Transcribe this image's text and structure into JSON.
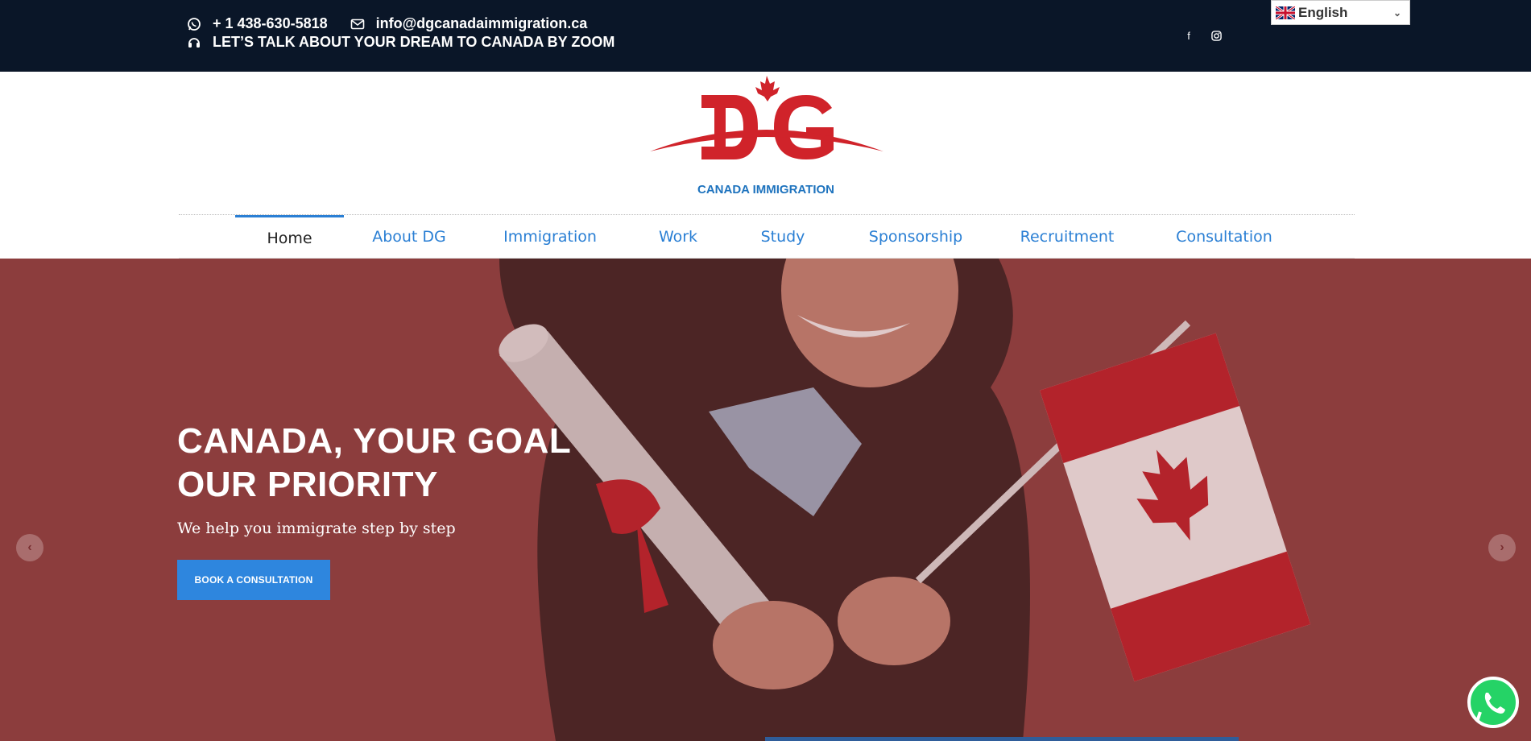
{
  "topbar": {
    "phone": "+ 1 438-630-5818",
    "email": "info@dgcanadaimmigration.ca",
    "zoom": "LET’S TALK ABOUT YOUR DREAM TO CANADA BY ZOOM",
    "language": "English"
  },
  "logo": {
    "letters": "DG",
    "tagline": "CANADA IMMIGRATION"
  },
  "nav": {
    "items": [
      {
        "label": "Home"
      },
      {
        "label": "About DG"
      },
      {
        "label": "Immigration"
      },
      {
        "label": "Work"
      },
      {
        "label": "Study"
      },
      {
        "label": "Sponsorship"
      },
      {
        "label": "Recruitment"
      },
      {
        "label": "Consultation"
      }
    ]
  },
  "hero": {
    "title_line1": "CANADA, YOUR GOAL",
    "title_line2": "OUR PRIORITY",
    "subtitle": "We help you immigrate step by step",
    "cta": "BOOK A CONSULTATION"
  },
  "colors": {
    "topbar": "#0a1628",
    "accent": "#2e86de",
    "brand_red": "#d0232a",
    "hero_bg": "#8c3d3e"
  }
}
